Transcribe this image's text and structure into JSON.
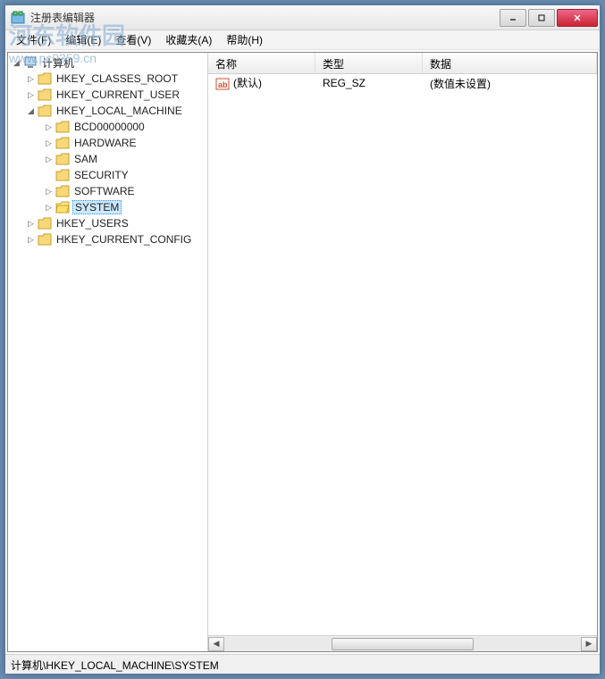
{
  "window": {
    "title": "注册表编辑器"
  },
  "menu": {
    "file": "文件(F)",
    "edit": "编辑(E)",
    "view": "查看(V)",
    "favorites": "收藏夹(A)",
    "help": "帮助(H)"
  },
  "tree": {
    "root": "计算机",
    "hkcr": "HKEY_CLASSES_ROOT",
    "hkcu": "HKEY_CURRENT_USER",
    "hklm": "HKEY_LOCAL_MACHINE",
    "hklm_children": {
      "bcd": "BCD00000000",
      "hardware": "HARDWARE",
      "sam": "SAM",
      "security": "SECURITY",
      "software": "SOFTWARE",
      "system": "SYSTEM"
    },
    "hku": "HKEY_USERS",
    "hkcc": "HKEY_CURRENT_CONFIG"
  },
  "list": {
    "headers": {
      "name": "名称",
      "type": "类型",
      "data": "数据"
    },
    "rows": [
      {
        "name": "(默认)",
        "type": "REG_SZ",
        "data": "(数值未设置)"
      }
    ]
  },
  "statusbar": "计算机\\HKEY_LOCAL_MACHINE\\SYSTEM",
  "watermark": {
    "text": "河东软件园",
    "url": "www.pc0359.cn"
  }
}
